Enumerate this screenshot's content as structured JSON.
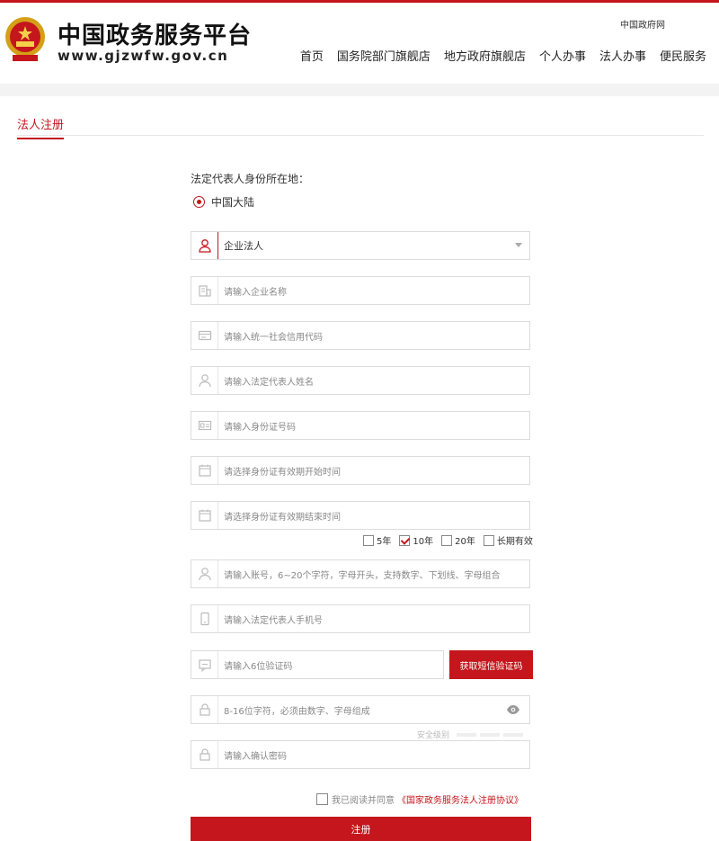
{
  "header": {
    "site_title": "中国政务服务平台",
    "site_url": "www.gjzwfw.gov.cn",
    "gov_link": "中国政府网",
    "nav": [
      "首页",
      "国务院部门旗舰店",
      "地方政府旗舰店",
      "个人办事",
      "法人办事",
      "便民服务"
    ]
  },
  "page_tab": "法人注册",
  "form": {
    "location_label": "法定代表人身份所在地：",
    "location_option": "中国大陆",
    "entity_type": "企业法人",
    "company_name_placeholder": "请输入企业名称",
    "credit_code_placeholder": "请输入统一社会信用代码",
    "rep_name_placeholder": "请输入法定代表人姓名",
    "id_number_placeholder": "请输入身份证号码",
    "id_start_placeholder": "请选择身份证有效期开始时间",
    "id_end_placeholder": "请选择身份证有效期结束时间",
    "validity_options": [
      {
        "label": "5年",
        "checked": false
      },
      {
        "label": "10年",
        "checked": true
      },
      {
        "label": "20年",
        "checked": false
      },
      {
        "label": "长期有效",
        "checked": false
      }
    ],
    "account_placeholder": "请输入账号，6~20个字符，字母开头，支持数字、下划线、字母组合",
    "phone_placeholder": "请输入法定代表人手机号",
    "sms_code_placeholder": "请输入6位验证码",
    "sms_button": "获取短信验证码",
    "password_placeholder": "8-16位字符，必须由数字、字母组成",
    "strength_label": "安全级别",
    "confirm_password_placeholder": "请输入确认密码",
    "agree_text": "我已阅读并同意",
    "agreement_link": "《国家政务服务法人注册协议》",
    "submit_label": "注册"
  },
  "colors": {
    "accent": "#c4161c"
  }
}
